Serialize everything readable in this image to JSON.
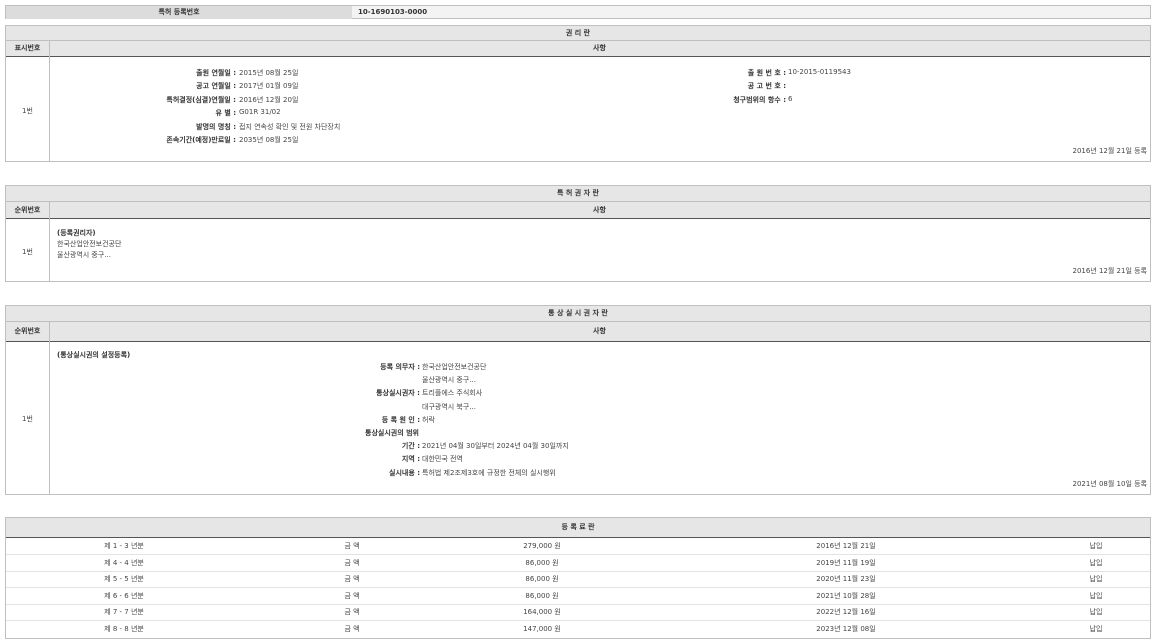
{
  "reg": {
    "label": "특허 등록번호",
    "value": "10-1690103-0000"
  },
  "rights": {
    "title": "권 리 란",
    "col_no": "표시번호",
    "col_item": "사항",
    "row_no": "1번",
    "left_fields": [
      {
        "label": "출원 연월일 :",
        "value": "2015년 08월 25일"
      },
      {
        "label": "공고 연월일 :",
        "value": "2017년 01월 09일"
      },
      {
        "label": "특허결정(심결)연월일 :",
        "value": "2016년 12월 20일"
      },
      {
        "label": "유 별 :",
        "value": "G01R 31/02"
      },
      {
        "label": "발명의 명칭 :",
        "value": "접지 연속성 확인 및 전원 차단장치"
      },
      {
        "label": "존속기간(예정)만료일 :",
        "value": "2035년 08월 25일"
      }
    ],
    "right_fields": [
      {
        "label": "출 원 번 호 :",
        "value": "10-2015-0119543"
      },
      {
        "label": "공 고 번 호 :",
        "value": ""
      },
      {
        "label": "청구범위의 항수 :",
        "value": "6"
      }
    ],
    "date": "2016년 12월 21일 등록"
  },
  "owners": {
    "title": "특 허 권 자 란",
    "col_no": "순위번호",
    "col_item": "사항",
    "row_no": "1번",
    "heading": "(등록권리자)",
    "lines": [
      "한국산업안전보건공단",
      "울산광역시 중구..."
    ],
    "date": "2016년 12월 21일 등록"
  },
  "license": {
    "title": "통 상 실 시 권 자 란",
    "col_no": "순위번호",
    "col_item": "사항",
    "row_no": "1번",
    "heading": "(통상실시권의 설정등록)",
    "fields": [
      {
        "label": "등록 의무자 :",
        "value": "한국산업안전보건공단",
        "bold": false
      },
      {
        "label": "",
        "value": "울산광역시 중구...",
        "bold": false
      },
      {
        "label": "통상실시권자 :",
        "value": "트리플에스 주식회사",
        "bold": false
      },
      {
        "label": "",
        "value": "대구광역시 북구...",
        "bold": false
      },
      {
        "label": "등 록 원 인 :",
        "value": "허락",
        "bold": false
      },
      {
        "label": "통상실시권의 범위",
        "value": "",
        "bold": true
      },
      {
        "label": "기간 :",
        "value": "2021년 04월 30일부터 2024년 04월 30일까지",
        "bold": false
      },
      {
        "label": "지역 :",
        "value": "대한민국 전역",
        "bold": false
      },
      {
        "label": "실시내용 :",
        "value": "특허법 제2조제3호에 규정한 전체의 실시행위",
        "bold": false
      }
    ],
    "date": "2021년 08월 10일 등록"
  },
  "fees": {
    "title": "등 록 료 란",
    "rows": [
      {
        "year": "제 1 - 3 년분",
        "kind": "금 액",
        "amount": "279,000 원",
        "date": "2016년 12월 21일",
        "status": "납입"
      },
      {
        "year": "제 4 - 4 년분",
        "kind": "금 액",
        "amount": "86,000 원",
        "date": "2019년 11월 19일",
        "status": "납입"
      },
      {
        "year": "제 5 - 5 년분",
        "kind": "금 액",
        "amount": "86,000 원",
        "date": "2020년 11월 23일",
        "status": "납입"
      },
      {
        "year": "제 6 - 6 년분",
        "kind": "금 액",
        "amount": "86,000 원",
        "date": "2021년 10월 28일",
        "status": "납입"
      },
      {
        "year": "제 7 - 7 년분",
        "kind": "금 액",
        "amount": "164,000 원",
        "date": "2022년 12월 16일",
        "status": "납입"
      },
      {
        "year": "제 8 - 8 년분",
        "kind": "금 액",
        "amount": "147,000 원",
        "date": "2023년 12월 08일",
        "status": "납입"
      }
    ]
  }
}
